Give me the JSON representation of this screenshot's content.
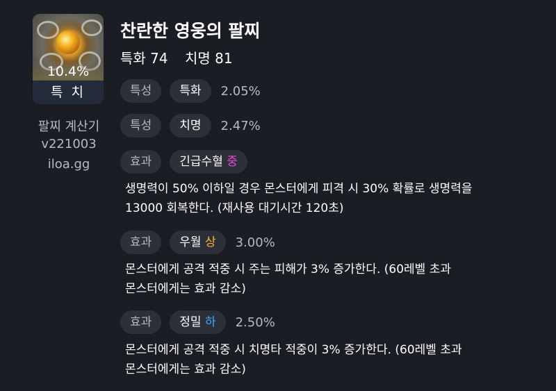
{
  "item": {
    "icon": "bracelet-gem-icon",
    "percent": "10.4%",
    "engrave": "특 치"
  },
  "credit": {
    "name": "팔찌 계산기",
    "version": "v221003",
    "site": "iloa.gg"
  },
  "title": "찬란한 영웅의 팔찌",
  "stats": {
    "s1": "특화 74",
    "s2": "치명 81"
  },
  "rows": [
    {
      "type": "특성",
      "name": "특화",
      "grade": "",
      "value": "2.05%"
    },
    {
      "type": "특성",
      "name": "치명",
      "grade": "",
      "value": "2.47%"
    },
    {
      "type": "효과",
      "name": "긴급수혈",
      "grade": "중",
      "value": "",
      "desc_line1": "생명력이 50% 이하일 경우 몬스터에게 피격 시 30% 확률로 생명력을",
      "desc_line2": "13000 회복한다. (재사용 대기시간 120초)"
    },
    {
      "type": "효과",
      "name": "우월",
      "grade": "상",
      "value": "3.00%",
      "desc_line1": "몬스터에게 공격 적중 시 주는 피해가 3% 증가한다. (60레벨 초과",
      "desc_line2": "몬스터에게는 효과 감소)"
    },
    {
      "type": "효과",
      "name": "정밀",
      "grade": "하",
      "value": "2.50%",
      "desc_line1": "몬스터에게 공격 적중 시 치명타 적중이 3% 증가한다. (60레벨 초과",
      "desc_line2": "몬스터에게는 효과 감소)"
    }
  ],
  "colors": {
    "background": "#1b1d24",
    "chip": "#2d3038",
    "grade_mid": "#e34bd6",
    "grade_high": "#f5b731",
    "grade_low": "#3aa8ff"
  }
}
